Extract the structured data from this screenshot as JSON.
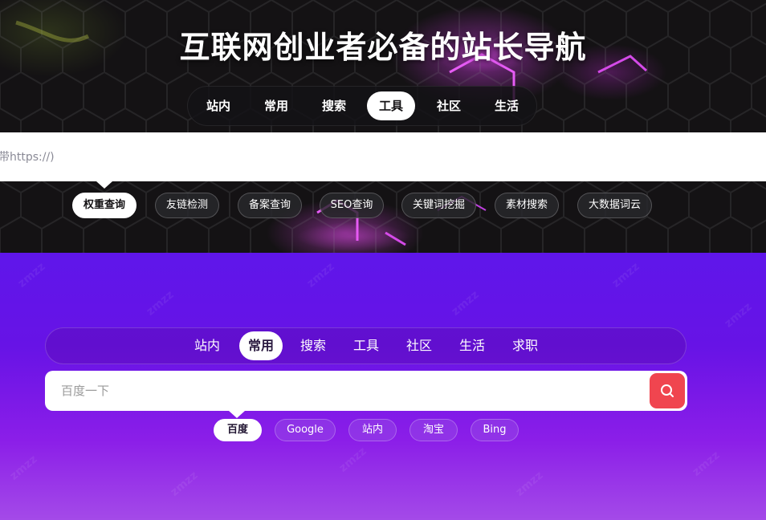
{
  "hero": {
    "title": "互联网创业者必备的站长导航",
    "tabs": [
      {
        "label": "站内",
        "active": false
      },
      {
        "label": "常用",
        "active": false
      },
      {
        "label": "搜索",
        "active": false
      },
      {
        "label": "工具",
        "active": true
      },
      {
        "label": "社区",
        "active": false
      },
      {
        "label": "生活",
        "active": false
      }
    ],
    "search": {
      "placeholder": "不带https://)",
      "value": ""
    },
    "chips": [
      {
        "label": "权重查询",
        "active": true
      },
      {
        "label": "友链检测",
        "active": false
      },
      {
        "label": "备案查询",
        "active": false
      },
      {
        "label": "SEO查询",
        "active": false
      },
      {
        "label": "关键词挖掘",
        "active": false
      },
      {
        "label": "素材搜索",
        "active": false
      },
      {
        "label": "大数据词云",
        "active": false
      }
    ]
  },
  "lower": {
    "watermark": "zmzz",
    "tabs": [
      {
        "label": "站内",
        "active": false
      },
      {
        "label": "常用",
        "active": true
      },
      {
        "label": "搜索",
        "active": false
      },
      {
        "label": "工具",
        "active": false
      },
      {
        "label": "社区",
        "active": false
      },
      {
        "label": "生活",
        "active": false
      },
      {
        "label": "求职",
        "active": false
      }
    ],
    "search": {
      "placeholder": "百度一下",
      "value": "",
      "button_icon": "search-icon"
    },
    "chips": [
      {
        "label": "百度",
        "active": true
      },
      {
        "label": "Google",
        "active": false
      },
      {
        "label": "站内",
        "active": false
      },
      {
        "label": "淘宝",
        "active": false
      },
      {
        "label": "Bing",
        "active": false
      }
    ]
  },
  "colors": {
    "accent_red": "#f0454f",
    "purple_top": "#5f16ea",
    "purple_bottom": "#a44ae8",
    "hero_dark": "#141214",
    "neon_pink": "#e040f0"
  }
}
